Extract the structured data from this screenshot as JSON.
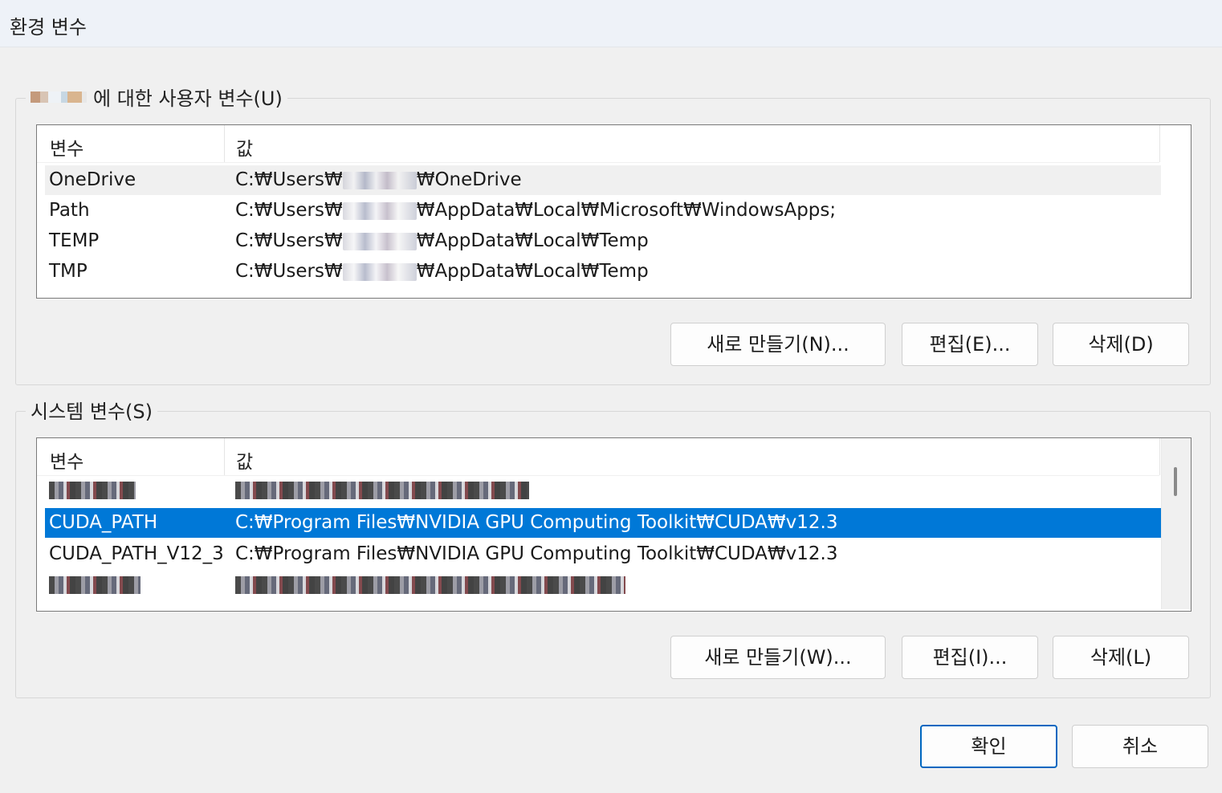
{
  "window": {
    "title": "환경 변수"
  },
  "user_vars": {
    "legend": "에 대한 사용자 변수(U)",
    "columns": {
      "name": "변수",
      "value": "값"
    },
    "rows": [
      {
        "name": "OneDrive",
        "value_prefix": "C:₩Users₩",
        "value_suffix": "₩OneDrive"
      },
      {
        "name": "Path",
        "value_prefix": "C:₩Users₩",
        "value_suffix": "₩AppData₩Local₩Microsoft₩WindowsApps;"
      },
      {
        "name": "TEMP",
        "value_prefix": "C:₩Users₩",
        "value_suffix": "₩AppData₩Local₩Temp"
      },
      {
        "name": "TMP",
        "value_prefix": "C:₩Users₩",
        "value_suffix": "₩AppData₩Local₩Temp"
      }
    ],
    "buttons": {
      "new": "새로 만들기(N)...",
      "edit": "편집(E)...",
      "delete": "삭제(D)"
    }
  },
  "system_vars": {
    "legend": "시스템 변수(S)",
    "columns": {
      "name": "변수",
      "value": "값"
    },
    "rows": [
      {
        "name": "",
        "value": ""
      },
      {
        "name": "CUDA_PATH",
        "value": "C:₩Program Files₩NVIDIA GPU Computing Toolkit₩CUDA₩v12.3",
        "selected": true
      },
      {
        "name": "CUDA_PATH_V12_3",
        "value": "C:₩Program Files₩NVIDIA GPU Computing Toolkit₩CUDA₩v12.3"
      },
      {
        "name": "",
        "value": ""
      }
    ],
    "buttons": {
      "new": "새로 만들기(W)...",
      "edit": "편집(I)...",
      "delete": "삭제(L)"
    }
  },
  "footer": {
    "ok": "확인",
    "cancel": "취소"
  },
  "colors": {
    "selection": "#0078d7",
    "primary_border": "#0067c0"
  }
}
